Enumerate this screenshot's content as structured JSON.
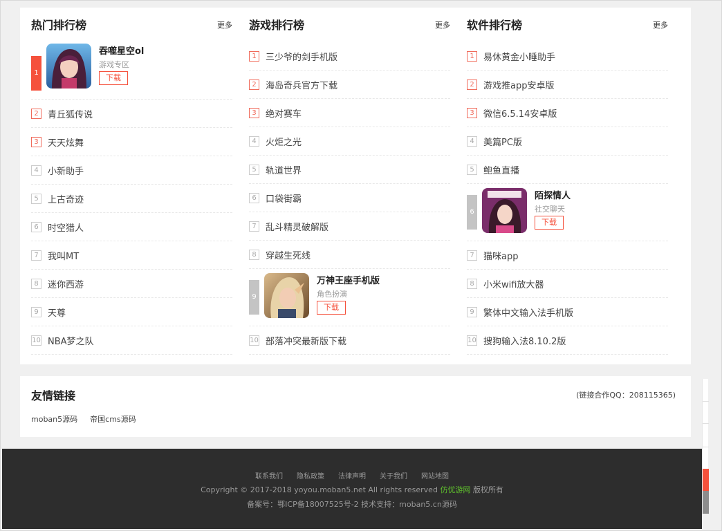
{
  "columns": [
    {
      "title": "热门排行榜",
      "more": "更多",
      "featured": {
        "rank": "1",
        "name": "吞噬星空ol",
        "category": "游戏专区",
        "button": "下载",
        "icon": "game-avatar-icon"
      },
      "items": [
        {
          "rank": "2",
          "name": "青丘狐传说",
          "hot": true
        },
        {
          "rank": "3",
          "name": "天天炫舞",
          "hot": true
        },
        {
          "rank": "4",
          "name": "小新助手",
          "hot": false
        },
        {
          "rank": "5",
          "name": "上古奇迹",
          "hot": false
        },
        {
          "rank": "6",
          "name": "时空猎人",
          "hot": false
        },
        {
          "rank": "7",
          "name": "我叫MT",
          "hot": false
        },
        {
          "rank": "8",
          "name": "迷你西游",
          "hot": false
        },
        {
          "rank": "9",
          "name": "天尊",
          "hot": false
        },
        {
          "rank": "10",
          "name": "NBA梦之队",
          "hot": false
        }
      ]
    },
    {
      "title": "游戏排行榜",
      "more": "更多",
      "items_before": [
        {
          "rank": "1",
          "name": "三少爷的剑手机版",
          "hot": true
        },
        {
          "rank": "2",
          "name": "海岛奇兵官方下载",
          "hot": true
        },
        {
          "rank": "3",
          "name": "绝对赛车",
          "hot": true
        },
        {
          "rank": "4",
          "name": "火炬之光",
          "hot": false
        },
        {
          "rank": "5",
          "name": "轨道世界",
          "hot": false
        },
        {
          "rank": "6",
          "name": "口袋街霸",
          "hot": false
        },
        {
          "rank": "7",
          "name": "乱斗精灵破解版",
          "hot": false
        },
        {
          "rank": "8",
          "name": "穿越生死线",
          "hot": false
        }
      ],
      "featured": {
        "rank": "9",
        "name": "万神王座手机版",
        "category": "角色扮演",
        "button": "下载",
        "icon": "game-avatar-icon"
      },
      "items_after": [
        {
          "rank": "10",
          "name": "部落冲突最新版下载",
          "hot": false
        }
      ]
    },
    {
      "title": "软件排行榜",
      "more": "更多",
      "items_before": [
        {
          "rank": "1",
          "name": "易休黄金小睡助手",
          "hot": true
        },
        {
          "rank": "2",
          "name": "游戏推app安卓版",
          "hot": true
        },
        {
          "rank": "3",
          "name": "微信6.5.14安卓版",
          "hot": true
        },
        {
          "rank": "4",
          "name": "美篇PC版",
          "hot": false
        },
        {
          "rank": "5",
          "name": "鲍鱼直播",
          "hot": false
        }
      ],
      "featured": {
        "rank": "6",
        "name": "陌探情人",
        "category": "社交聊天",
        "button": "下载",
        "icon": "app-avatar-icon"
      },
      "items_after": [
        {
          "rank": "7",
          "name": "猫咪app",
          "hot": false
        },
        {
          "rank": "8",
          "name": "小米wifi放大器",
          "hot": false
        },
        {
          "rank": "9",
          "name": "繁体中文输入法手机版",
          "hot": false
        },
        {
          "rank": "10",
          "name": "搜狗输入法8.10.2版",
          "hot": false
        }
      ]
    }
  ],
  "friend_links": {
    "title": "友情链接",
    "qq": "(链接合作QQ：208115365)",
    "links": [
      "moban5源码",
      "帝国cms源码"
    ]
  },
  "footer": {
    "nav": [
      "联系我们",
      "隐私政策",
      "法律声明",
      "关于我们",
      "网站地图"
    ],
    "copyright_pre": "Copyright © 2017-2018 yoyou.moban5.net All rights reserved ",
    "copyright_brand": "仿优游网",
    "copyright_post": " 版权所有",
    "icp": "备案号：鄂ICP备18007525号-2  技术支持：moban5.cn源码"
  },
  "colors": {
    "accent": "#f5513c",
    "brand_green": "#5fbf2d",
    "footer_bg": "#2d2d2d"
  }
}
